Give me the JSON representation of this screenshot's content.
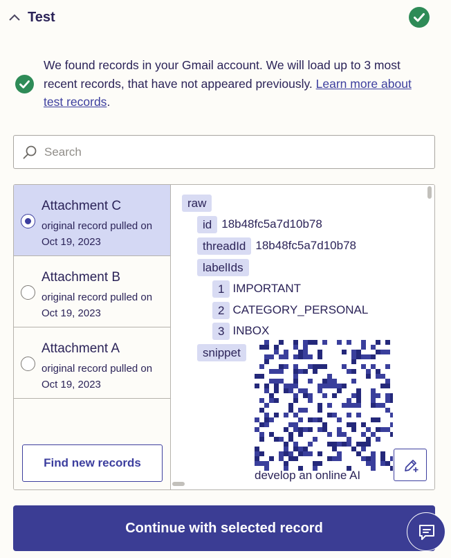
{
  "header": {
    "title": "Test"
  },
  "message": {
    "text": "We found records in your Gmail account. We will load up to 3 most recent records, that have not appeared previously. ",
    "link": "Learn more about test records",
    "after_link": "."
  },
  "search": {
    "placeholder": "Search",
    "value": ""
  },
  "records": [
    {
      "name": "Attachment C",
      "sub": "original record pulled on Oct 19, 2023",
      "selected": true
    },
    {
      "name": "Attachment B",
      "sub": "original record pulled on Oct 19, 2023",
      "selected": false
    },
    {
      "name": "Attachment A",
      "sub": "original record pulled on Oct 19, 2023",
      "selected": false
    }
  ],
  "find_button": "Find new records",
  "detail": {
    "root_key": "raw",
    "id_key": "id",
    "id_value": "18b48fc5a7d10b78",
    "thread_key": "threadId",
    "thread_value": "18b48fc5a7d10b78",
    "labels_key": "labelIds",
    "labels": [
      {
        "index": "1",
        "value": "IMPORTANT"
      },
      {
        "index": "2",
        "value": "CATEGORY_PERSONAL"
      },
      {
        "index": "3",
        "value": "INBOX"
      }
    ],
    "snippet_key": "snippet",
    "snippet_fragments": [
      "ng",
      "ael",
      "ur",
      "develop an online AI"
    ]
  },
  "continue_button": "Continue with selected record",
  "colors": {
    "accent": "#3b3d94",
    "success": "#2e8b57",
    "selected_bg": "#d4d8f4",
    "key_bg": "#d8dbf3"
  },
  "icons": {
    "header_status": "check-circle-icon",
    "message_status": "check-circle-icon",
    "search": "search-icon",
    "edit": "edit-plus-icon",
    "chat": "chat-icon",
    "collapse": "chevron-up-icon"
  }
}
